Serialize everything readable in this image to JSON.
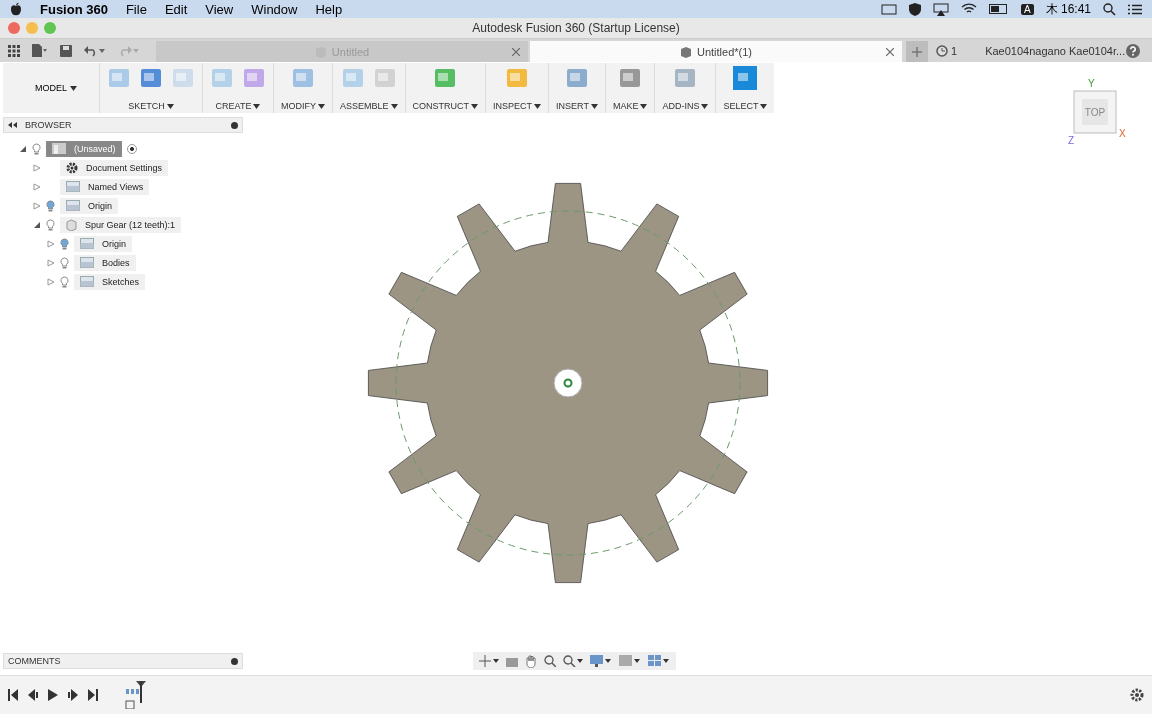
{
  "menubar": {
    "app_name": "Fusion 360",
    "menus": [
      "File",
      "Edit",
      "View",
      "Window",
      "Help"
    ],
    "clock": "木 16:41",
    "input_mode": "A"
  },
  "window": {
    "title": "Autodesk Fusion 360 (Startup License)"
  },
  "tabs": [
    {
      "label": "Untitled",
      "selected": false
    },
    {
      "label": "Untitled*(1)",
      "selected": true
    }
  ],
  "job_count": "1",
  "user": "Kae0104nagano Kae0104r...",
  "toolbar": {
    "workspace": "MODEL",
    "groups": [
      {
        "label": "SKETCH",
        "selected": false
      },
      {
        "label": "CREATE",
        "selected": false
      },
      {
        "label": "MODIFY",
        "selected": false
      },
      {
        "label": "ASSEMBLE",
        "selected": false
      },
      {
        "label": "CONSTRUCT",
        "selected": false
      },
      {
        "label": "INSPECT",
        "selected": false
      },
      {
        "label": "INSERT",
        "selected": false
      },
      {
        "label": "MAKE",
        "selected": false
      },
      {
        "label": "ADD-INS",
        "selected": false
      },
      {
        "label": "SELECT",
        "selected": true
      }
    ]
  },
  "browser": {
    "title": "BROWSER",
    "items": [
      {
        "label": "(Unsaved)",
        "kind": "document",
        "expanded": true,
        "light_on": false,
        "selected": true,
        "children": [
          {
            "label": "Document Settings",
            "kind": "settings",
            "expanded": false,
            "selected": false
          },
          {
            "label": "Named Views",
            "kind": "folder",
            "expanded": false,
            "selected": false
          },
          {
            "label": "Origin",
            "kind": "folder",
            "expanded": false,
            "light_on": true,
            "selected": false
          },
          {
            "label": "Spur Gear (12 teeth):1",
            "kind": "component",
            "expanded": true,
            "light_on": false,
            "selected": false,
            "children": [
              {
                "label": "Origin",
                "kind": "folder",
                "expanded": false,
                "light_on": true,
                "selected": false
              },
              {
                "label": "Bodies",
                "kind": "folder",
                "expanded": false,
                "light_on": false,
                "selected": false
              },
              {
                "label": "Sketches",
                "kind": "folder",
                "expanded": false,
                "light_on": false,
                "selected": false
              }
            ]
          }
        ]
      }
    ]
  },
  "viewcube": {
    "face": "TOP",
    "axis_x": "X",
    "axis_y": "Y",
    "axis_z": "Z"
  },
  "comments": {
    "title": "COMMENTS"
  }
}
